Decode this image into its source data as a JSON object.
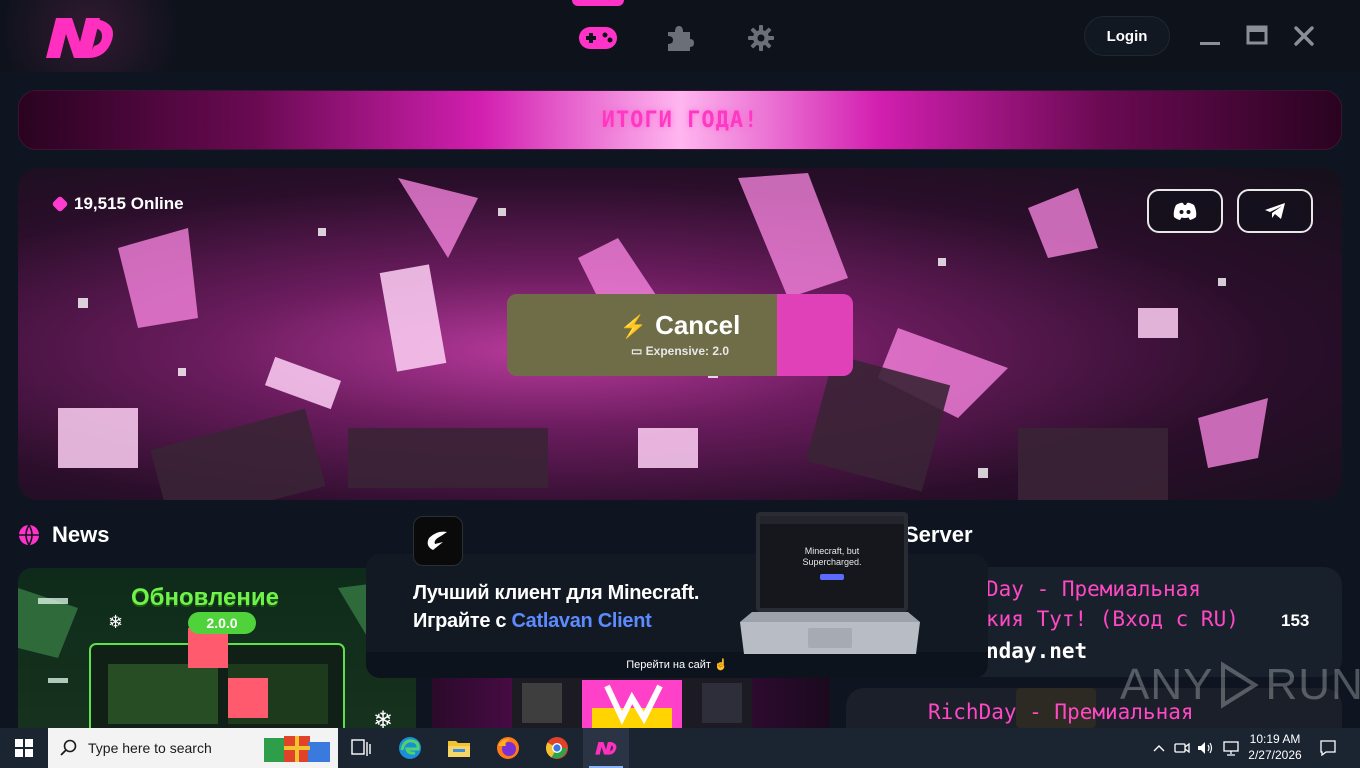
{
  "app": {
    "nav_tabs": [
      {
        "icon": "gamepad-icon",
        "active": true
      },
      {
        "icon": "puzzle-icon",
        "active": false
      },
      {
        "icon": "gear-icon",
        "active": false
      }
    ],
    "login_label": "Login",
    "accent": "#ff33c8"
  },
  "banner": {
    "text": "ИТОГИ ГОДА!"
  },
  "hero": {
    "online_text": "19,515 Online",
    "social": [
      {
        "icon": "discord-icon"
      },
      {
        "icon": "telegram-icon"
      }
    ],
    "play": {
      "label": "Cancel",
      "sub_label": "Expensive: 2.0",
      "progress": 0.78
    }
  },
  "sections": {
    "news_title": "News",
    "server_title": "Server"
  },
  "news": [
    {
      "title": "Обновление",
      "version": "2.0.0"
    },
    {
      "title": ""
    }
  ],
  "servers": [
    {
      "name_line1": "Day - Премиальная",
      "name_line2": "кия Тут! (Вход с RU)",
      "address": "nday.net",
      "players": "153"
    },
    {
      "name_line1": "RichDay - Премиальная"
    }
  ],
  "ad": {
    "line1": "Лучший клиент для Minecraft.",
    "line2_prefix": "Играйте с ",
    "line2_highlight": "Catlavan Client",
    "cta": "Перейти на сайт",
    "laptop_text_1": "Minecraft, but",
    "laptop_text_2": "Supercharged."
  },
  "watermark": {
    "text_left": "ANY",
    "text_right": "RUN"
  },
  "taskbar": {
    "search_placeholder": "Type here to search",
    "apps": [
      "task-view-icon",
      "edge-icon",
      "file-explorer-icon",
      "firefox-icon",
      "chrome-icon",
      "nursultan-app-icon"
    ],
    "time": "10:19 AM",
    "date": "2/27/2026"
  }
}
